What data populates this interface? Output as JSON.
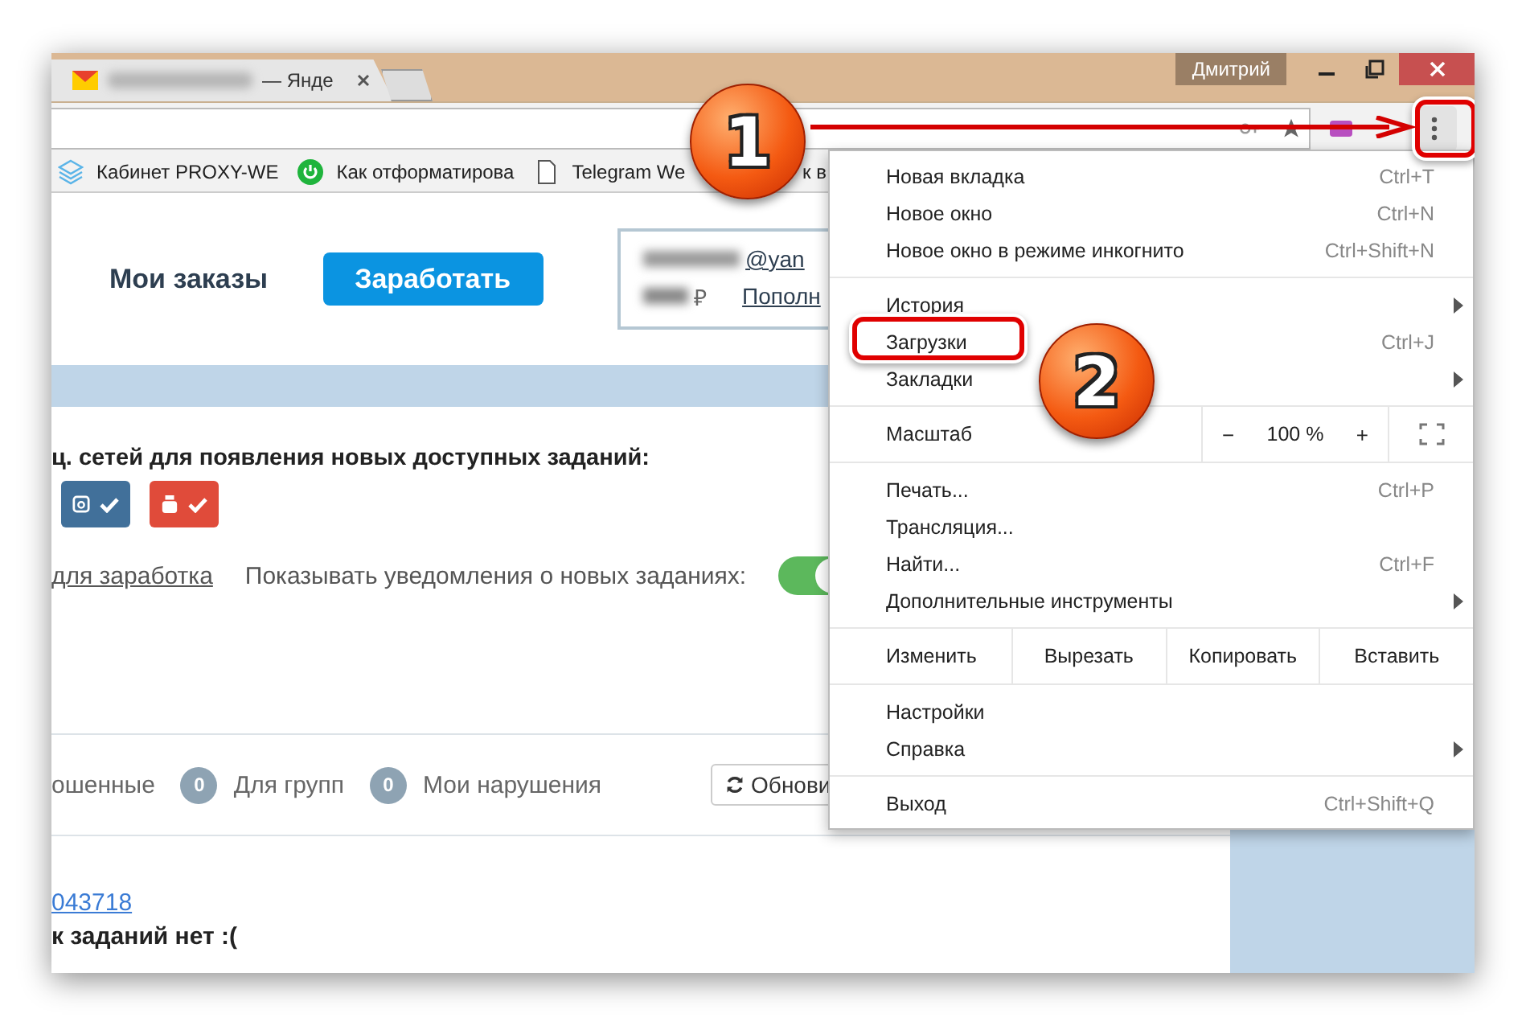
{
  "tab": {
    "title": "— Янде",
    "selected": true
  },
  "profile": "Дмитрий",
  "bookmarks": [
    {
      "kind": "box",
      "label": "Кабинет PROXY-WE"
    },
    {
      "kind": "power",
      "label": "Как отформатирова"
    },
    {
      "kind": "page",
      "label": "Telegram We"
    },
    {
      "kind": "plain",
      "label": "к в"
    }
  ],
  "page": {
    "orders_link": "Мои заказы",
    "earn_button": "Заработать",
    "account": {
      "email": "@yan",
      "currency": "₽",
      "top_up_link": "Пополн"
    },
    "networks_title": "ц. сетей для появления новых доступных заданий:",
    "networks": [
      {
        "kind": "instagram",
        "color": "#41709a",
        "checked": true
      },
      {
        "kind": "youtube",
        "color": "#e04b3a",
        "checked": true
      }
    ],
    "earn_link": "для заработка",
    "notify_label": "Показывать уведомления о новых заданиях:",
    "notify_on": true,
    "filters": [
      {
        "label": "ошенные"
      },
      {
        "count": "0",
        "label": "Для групп"
      },
      {
        "count": "0",
        "label": "Мои нарушения"
      }
    ],
    "refresh_button": "Обнови",
    "task_link": "043718",
    "empty_message": "к заданий нет :("
  },
  "menu": {
    "items": [
      {
        "kind": "item",
        "label": "Новая вкладка",
        "shortcut": "Ctrl+T"
      },
      {
        "kind": "item",
        "label": "Новое окно",
        "shortcut": "Ctrl+N"
      },
      {
        "kind": "item",
        "label": "Новое окно в режиме инкогнито",
        "shortcut": "Ctrl+Shift+N"
      },
      {
        "kind": "separator"
      },
      {
        "kind": "submenu",
        "label": "История"
      },
      {
        "kind": "item",
        "label": "Загрузки",
        "shortcut": "Ctrl+J"
      },
      {
        "kind": "submenu",
        "label": "Закладки"
      },
      {
        "kind": "separator"
      },
      {
        "kind": "zoom",
        "label": "Масштаб",
        "minus": "−",
        "value": "100 %",
        "plus": "+"
      },
      {
        "kind": "separator"
      },
      {
        "kind": "item",
        "label": "Печать...",
        "shortcut": "Ctrl+P"
      },
      {
        "kind": "item",
        "label": "Трансляция..."
      },
      {
        "kind": "item",
        "label": "Найти...",
        "shortcut": "Ctrl+F"
      },
      {
        "kind": "submenu",
        "label": "Дополнительные инструменты"
      },
      {
        "kind": "separator"
      },
      {
        "kind": "edit",
        "label": "Изменить",
        "actions": [
          "Вырезать",
          "Копировать",
          "Вставить"
        ]
      },
      {
        "kind": "separator"
      },
      {
        "kind": "item",
        "label": "Настройки"
      },
      {
        "kind": "submenu",
        "label": "Справка"
      },
      {
        "kind": "separator"
      },
      {
        "kind": "item",
        "label": "Выход",
        "shortcut": "Ctrl+Shift+Q"
      }
    ]
  },
  "annotations": [
    {
      "number": "1"
    },
    {
      "number": "2"
    }
  ]
}
